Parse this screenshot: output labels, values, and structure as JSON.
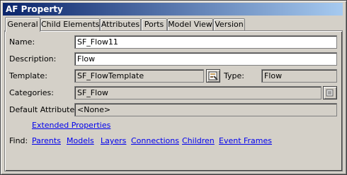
{
  "window": {
    "title": "AF Property"
  },
  "tabs": [
    {
      "label": "General"
    },
    {
      "label": "Child Elements"
    },
    {
      "label": "Attributes"
    },
    {
      "label": "Ports"
    },
    {
      "label": "Model View"
    },
    {
      "label": "Version"
    }
  ],
  "form": {
    "name_label": "Name:",
    "name_value": "SF_Flow11",
    "description_label": "Description:",
    "description_value": "Flow",
    "template_label": "Template:",
    "template_value": "SF_FlowTemplate",
    "type_label": "Type:",
    "type_value": "Flow",
    "categories_label": "Categories:",
    "categories_value": "SF_Flow",
    "default_attr_label": "Default Attribute:",
    "default_attr_value": "<None>"
  },
  "links": {
    "extended_properties": "Extended Properties",
    "find_label": "Find:",
    "parents": "Parents",
    "models": "Models",
    "layers": "Layers",
    "connections": "Connections",
    "children": "Children",
    "event_frames": "Event Frames"
  },
  "icons": {
    "template_button": "template-browse-icon",
    "categories_button": "categories-browse-icon"
  }
}
